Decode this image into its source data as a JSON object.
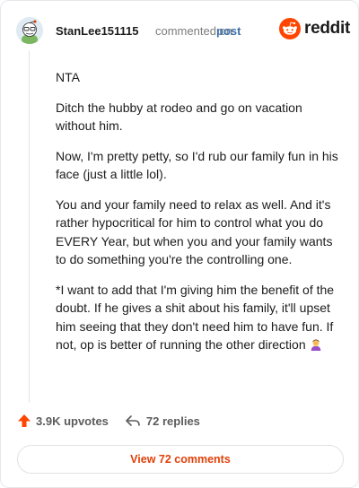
{
  "comment": {
    "username": "StanLee151115",
    "action_text": "commented on",
    "post_link": "post",
    "paragraphs": [
      "NTA",
      "Ditch the hubby at rodeo and go on vacation without him.",
      "Now, I'm pretty petty, so I'd rub our family fun in his face (just a little lol).",
      "You and your family need to relax as well. And it's rather hypocritical for him to control what you do EVERY Year, but when you and your family wants to do something you're the controlling one.",
      "*I want to add that I'm giving him the benefit of the doubt. If he gives a shit about his family, it'll upset him seeing that they don't need him to have fun. If not, op is better of running the other direction"
    ],
    "emoji_icon": "person-facepalming-emoji"
  },
  "brand": {
    "wordmark": "reddit",
    "icon": "reddit-alien-icon",
    "color": "#ff4500"
  },
  "footer": {
    "upvotes": "3.9K upvotes",
    "replies": "72 replies",
    "upvote_icon": "upvote-arrow-icon",
    "reply_icon": "reply-arrow-icon",
    "upvote_color": "#ff4500"
  },
  "view_button": {
    "label": "View 72 comments",
    "color": "#e0410b"
  }
}
